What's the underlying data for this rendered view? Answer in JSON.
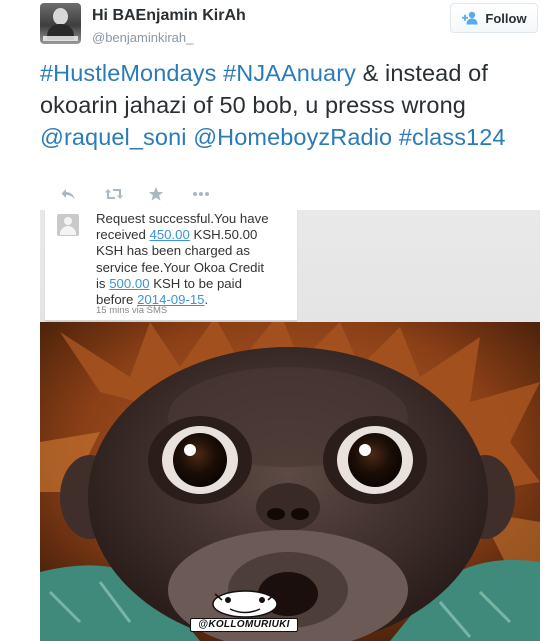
{
  "user": {
    "display_name": "Hi BAEnjamin KirAh",
    "handle": "@benjaminkirah_"
  },
  "follow_button": {
    "label": "Follow",
    "icon": "add-user-icon"
  },
  "tweet": {
    "hashtag_1": "#HustleMondays",
    "hashtag_2": "#NJAAnuary",
    "text_1": " & instead of okoarin jahazi of 50 bob, u presss wrong ",
    "mention_1": "@raquel_soni",
    "mention_2": "@HomeboyzRadio",
    "hashtag_3": "#class124"
  },
  "actions": [
    {
      "name": "reply",
      "icon": "reply-icon"
    },
    {
      "name": "retweet",
      "icon": "retweet-icon"
    },
    {
      "name": "favorite",
      "icon": "star-icon"
    },
    {
      "name": "more",
      "icon": "more-icon"
    }
  ],
  "sms": {
    "line_1": "Request successful.You have",
    "received_prefix": "received ",
    "amount": "450.00",
    "received_suffix": " KSH.50.00",
    "line_3": "KSH has been charged as",
    "line_4": "service fee.Your Okoa Credit",
    "is_prefix": "is ",
    "credit": "500.00",
    "is_suffix": " KSH to be paid",
    "before_prefix": "before ",
    "date": "2014-09-15",
    "before_suffix": ".",
    "meta": "15 mins via SMS"
  },
  "watermark": {
    "text": "@KOLLOMURIUKI"
  },
  "colors": {
    "link": "#2b7bb9",
    "text": "#292f33",
    "muted": "#8899a6",
    "sms_link": "#3a95d8"
  }
}
